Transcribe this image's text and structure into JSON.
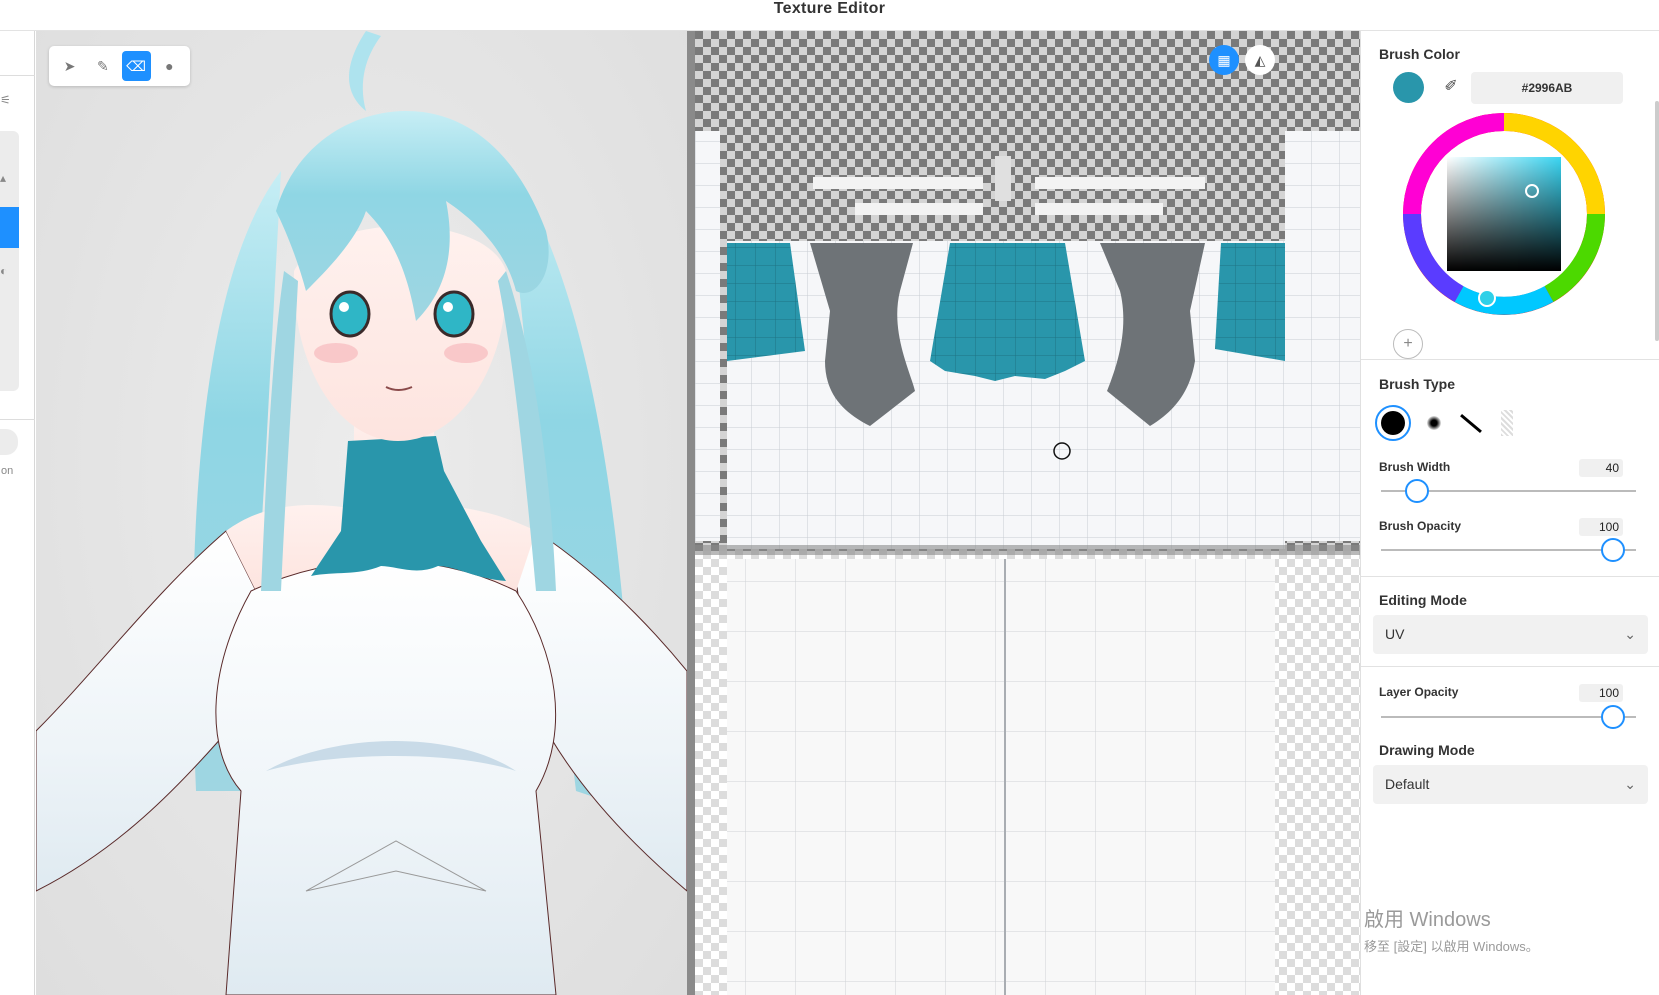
{
  "app": {
    "title": "Texture Editor"
  },
  "left_strip": {
    "partial_label": "on"
  },
  "toolbar": {
    "tools": [
      "select",
      "pen",
      "eraser",
      "fill"
    ],
    "active_tool": "eraser"
  },
  "uv_view": {
    "grid_toggle_icon": "grid-icon",
    "mirror_icon": "mirror-icon"
  },
  "colors": {
    "accent": "#1E90FF",
    "brush": "#2996AB",
    "mesh_dark": "#6E7377"
  },
  "panel": {
    "brush_color": {
      "title": "Brush Color",
      "hex": "#2996AB",
      "add_label": "+"
    },
    "brush_type": {
      "title": "Brush Type",
      "types": [
        "hard-round",
        "soft-round",
        "line",
        "texture"
      ],
      "selected": "hard-round"
    },
    "brush_width": {
      "label": "Brush Width",
      "value": "40",
      "fraction": 0.16
    },
    "brush_opacity": {
      "label": "Brush Opacity",
      "value": "100",
      "fraction": 1.0
    },
    "editing_mode": {
      "title": "Editing Mode",
      "value": "UV"
    },
    "layer_opacity": {
      "label": "Layer Opacity",
      "value": "100",
      "fraction": 1.0
    },
    "drawing_mode": {
      "title": "Drawing Mode",
      "value": "Default"
    }
  },
  "watermark": {
    "line1": "啟用 Windows",
    "line2": "移至 [設定] 以啟用 Windows。"
  }
}
